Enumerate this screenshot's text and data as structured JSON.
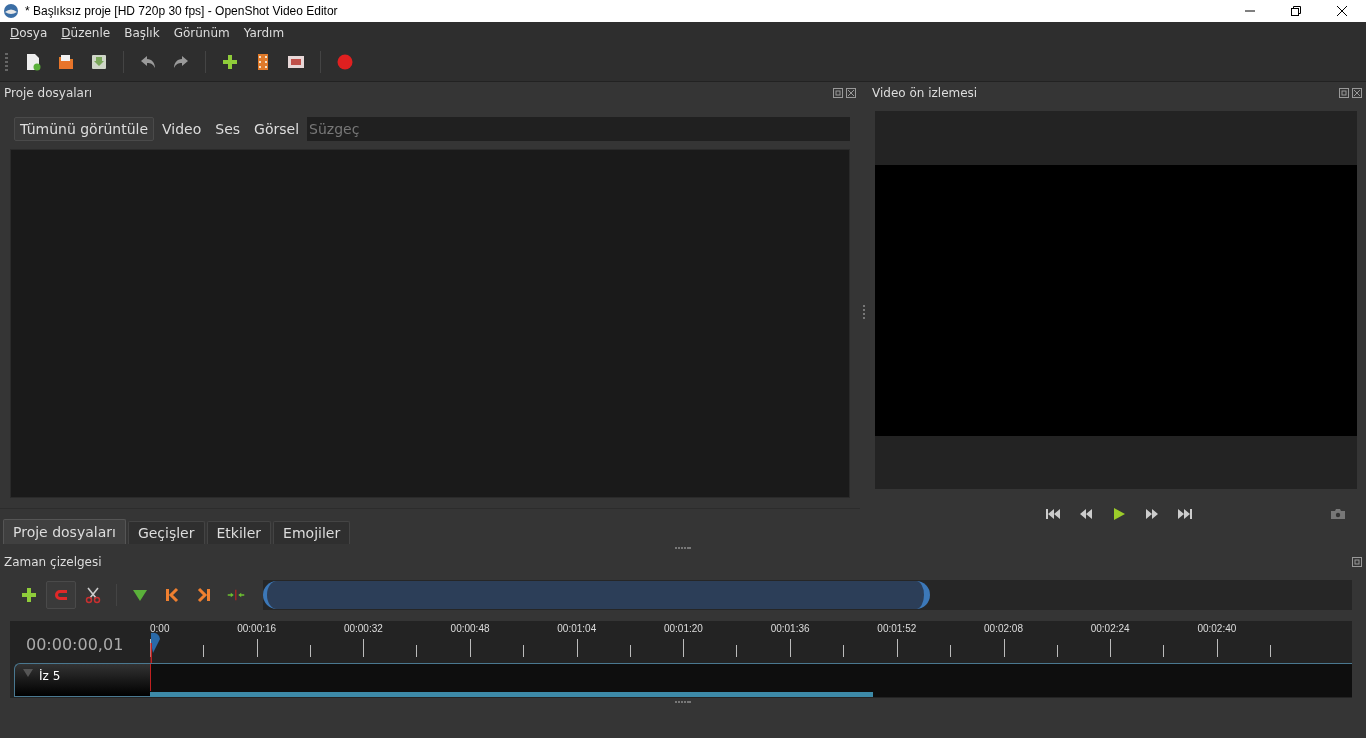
{
  "window": {
    "title": "* Başlıksız proje [HD 720p 30 fps] - OpenShot Video Editor"
  },
  "menu": [
    {
      "label": "Dosya",
      "underlined": true
    },
    {
      "label": "Düzenle",
      "underlined": true
    },
    {
      "label": "Başlık",
      "underlined": false
    },
    {
      "label": "Görünüm",
      "underlined": false
    },
    {
      "label": "Yardım",
      "underlined": false
    }
  ],
  "project_files": {
    "title": "Proje dosyaları",
    "filters": [
      {
        "label": "Tümünü görüntüle",
        "selected": true
      },
      {
        "label": "Video",
        "selected": false
      },
      {
        "label": "Ses",
        "selected": false
      },
      {
        "label": "Görsel",
        "selected": false
      }
    ],
    "search": {
      "placeholder": "Süzgeç"
    }
  },
  "bottom_tabs": [
    {
      "label": "Proje dosyaları",
      "selected": true
    },
    {
      "label": "Geçişler",
      "selected": false
    },
    {
      "label": "Etkiler",
      "selected": false
    },
    {
      "label": "Emojiler",
      "selected": false
    }
  ],
  "preview": {
    "title": "Video ön izlemesi"
  },
  "timeline": {
    "title": "Zaman çizelgesi",
    "timecode": "00:00:00,01",
    "ruler": [
      "0:00",
      "00:00:16",
      "00:00:32",
      "00:00:48",
      "00:01:04",
      "00:01:20",
      "00:01:36",
      "00:01:52",
      "00:02:08",
      "00:02:24",
      "00:02:40"
    ],
    "track": {
      "name": "İz 5"
    }
  }
}
